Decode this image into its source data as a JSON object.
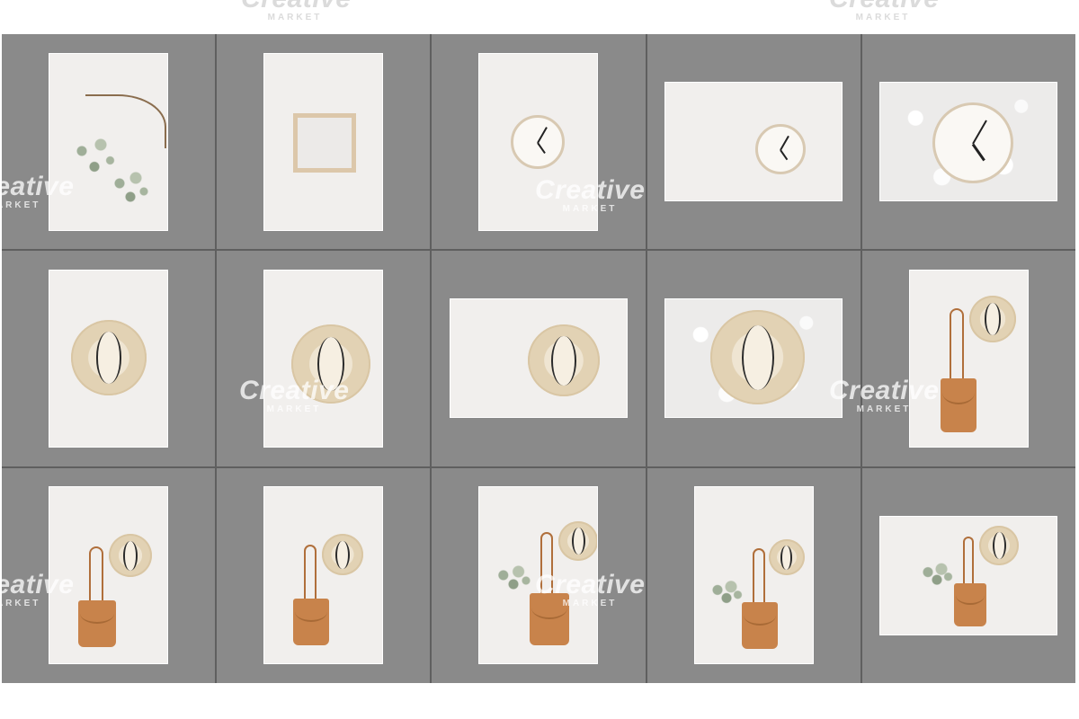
{
  "watermark": {
    "title": "Creative",
    "subtitle": "MARKET"
  },
  "grid": {
    "rows": 3,
    "columns": 5,
    "cell_background": "#8a8a8a",
    "gutter_color": "#5f5f5f",
    "page_background": "#ffffff"
  },
  "photos": [
    {
      "row": 1,
      "col": 1,
      "orientation": "portrait",
      "subject": "eucalyptus-and-cotton-branches"
    },
    {
      "row": 1,
      "col": 2,
      "orientation": "portrait",
      "subject": "letter-board-frame"
    },
    {
      "row": 1,
      "col": 3,
      "orientation": "portrait",
      "subject": "wall-clock"
    },
    {
      "row": 1,
      "col": 4,
      "orientation": "landscape",
      "subject": "wall-clock"
    },
    {
      "row": 1,
      "col": 5,
      "orientation": "landscape",
      "subject": "wall-clock-on-fur"
    },
    {
      "row": 2,
      "col": 1,
      "orientation": "portrait",
      "subject": "straw-hat"
    },
    {
      "row": 2,
      "col": 2,
      "orientation": "portrait",
      "subject": "straw-hat"
    },
    {
      "row": 2,
      "col": 3,
      "orientation": "landscape",
      "subject": "straw-hat"
    },
    {
      "row": 2,
      "col": 4,
      "orientation": "landscape",
      "subject": "straw-hat-on-fur"
    },
    {
      "row": 2,
      "col": 5,
      "orientation": "portrait",
      "subject": "hat-and-leather-backpack"
    },
    {
      "row": 3,
      "col": 1,
      "orientation": "portrait",
      "subject": "hat-and-leather-backpack"
    },
    {
      "row": 3,
      "col": 2,
      "orientation": "portrait",
      "subject": "hat-and-leather-backpack"
    },
    {
      "row": 3,
      "col": 3,
      "orientation": "portrait",
      "subject": "hat-backpack-and-eucalyptus"
    },
    {
      "row": 3,
      "col": 4,
      "orientation": "portrait",
      "subject": "hat-backpack-and-eucalyptus"
    },
    {
      "row": 3,
      "col": 5,
      "orientation": "landscape",
      "subject": "hat-backpack-and-eucalyptus"
    }
  ]
}
